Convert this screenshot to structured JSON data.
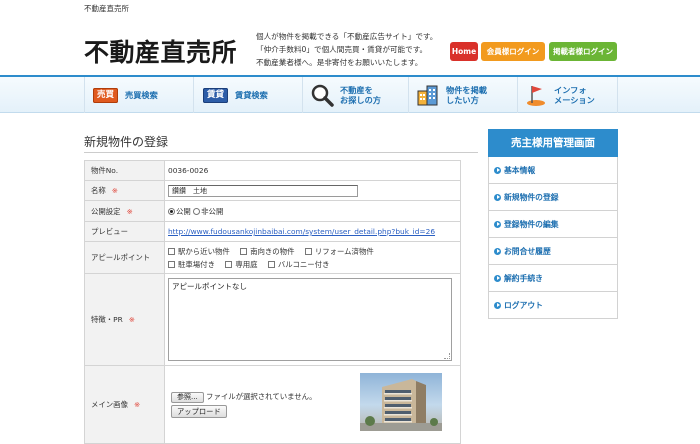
{
  "site": {
    "topline": "不動産直売所",
    "logo": "不動産直売所",
    "tagline": [
      "個人が物件を掲載できる「不動産広告サイト」です。",
      "「仲介手数料0」で個人間売買・賃貸が可能です。",
      "不動産業者様へ。是非寄付をお願いいたします。"
    ]
  },
  "header_buttons": {
    "home": "Home",
    "member_login": "会員様ログイン",
    "poster_login": "掲載者様ログイン"
  },
  "nav": [
    {
      "badge": "売買",
      "label": "売買検索"
    },
    {
      "badge": "賃貸",
      "label": "賃貸検索"
    },
    {
      "icon": "magnifier-icon",
      "label": "不動産を\nお探しの方"
    },
    {
      "icon": "building-icon",
      "label": "物件を掲載\nしたい方"
    },
    {
      "icon": "flag-icon",
      "label": "インフォ\nメーション"
    }
  ],
  "page_title": "新規物件の登録",
  "form": {
    "property_no": {
      "label": "物件No.",
      "value": "0036-0026"
    },
    "name": {
      "label": "名称",
      "required": "※",
      "value": "鑽鑽　土地"
    },
    "publish": {
      "label": "公開設定",
      "required": "※",
      "options": [
        "公開",
        "非公開"
      ],
      "selected": "公開"
    },
    "preview": {
      "label": "プレビュー",
      "url": "http://www.fudousankojinbaibai.com/system/user_detail.php?buk_id=26"
    },
    "appeal": {
      "label": "アピールポイント",
      "options": [
        "駅から近い物件",
        "南向きの物件",
        "リフォーム済物件",
        "駐車場付き",
        "専用庭",
        "バルコニー付き"
      ]
    },
    "features": {
      "label": "特徴・PR",
      "required": "※",
      "value": "アピールポイントなし"
    },
    "main_image": {
      "label": "メイン画像",
      "required": "※",
      "file_button": "参照...",
      "no_file": "ファイルが選択されていません。",
      "upload": "アップロード"
    }
  },
  "sidebar": {
    "title": "売主様用管理画面",
    "items": [
      "基本情報",
      "新規物件の登録",
      "登録物件の編集",
      "お問合せ履歴",
      "解約手続き",
      "ログアウト"
    ]
  },
  "colors": {
    "brand_blue": "#2d8ccc",
    "home_red": "#d9312a",
    "member_orange": "#f29a1e",
    "poster_green": "#6bb535",
    "required_red": "#e0473b"
  }
}
